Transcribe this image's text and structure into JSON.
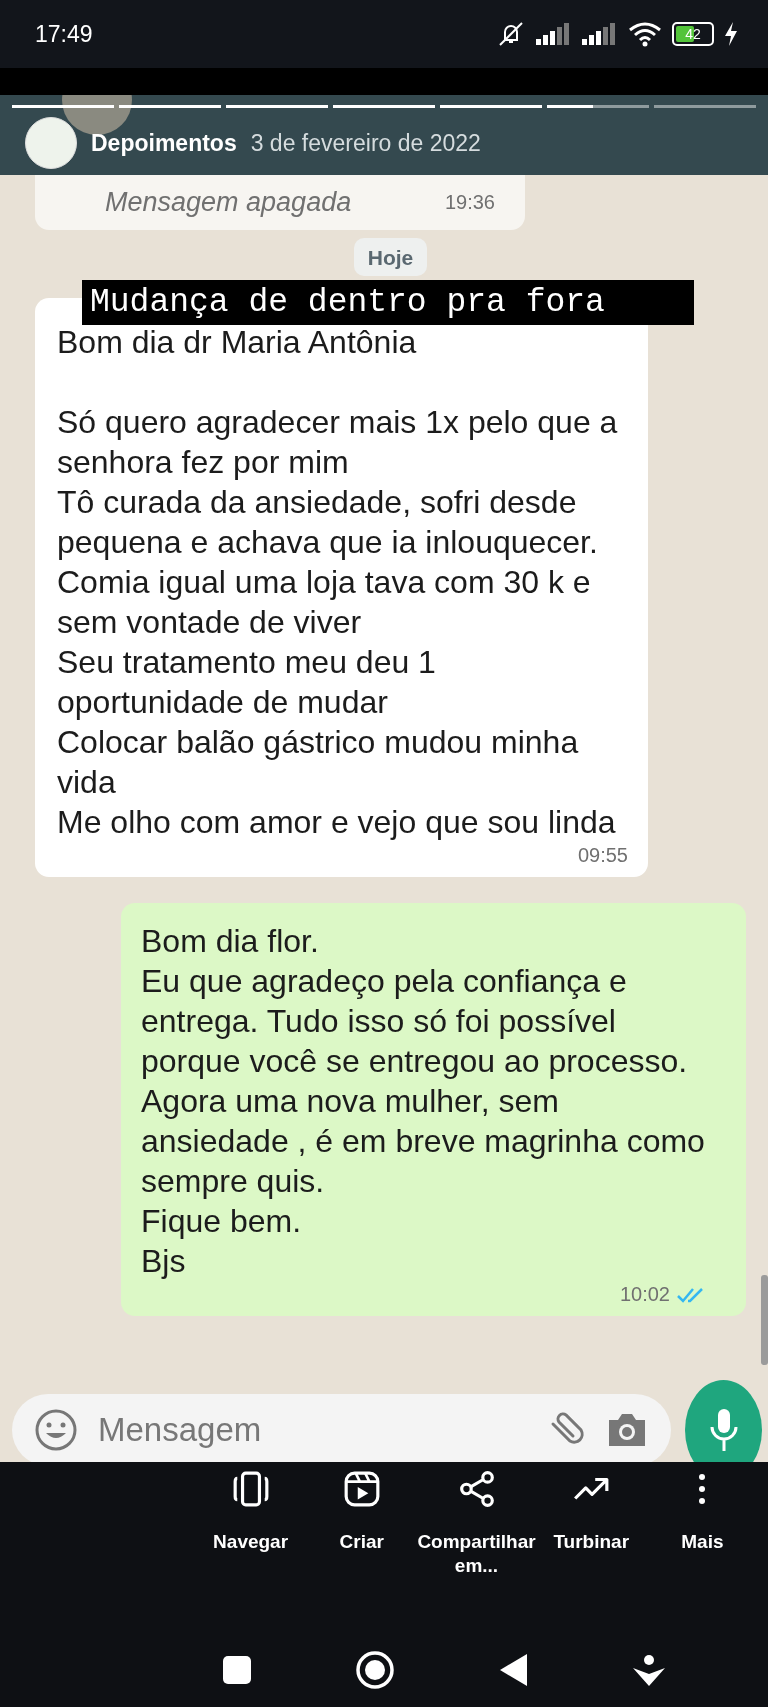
{
  "status_bar": {
    "time": "17:49",
    "battery": "42"
  },
  "story": {
    "progress": [
      {
        "level": 1
      },
      {
        "level": 1
      },
      {
        "level": 1
      },
      {
        "level": 1
      },
      {
        "level": 1
      },
      {
        "level": 0.45
      }
    ],
    "account": "Depoimentos",
    "date": "3 de fevereiro de 2022",
    "caption": "Mudança de dentro pra fora"
  },
  "chat": {
    "messages": [
      {
        "kind": "deleted",
        "text": "Mensagem apagada",
        "time": "19:36"
      },
      {
        "kind": "date",
        "text": "Hoje"
      },
      {
        "kind": "incoming",
        "text": "Bom dia dr Maria Antônia\n\nSó quero agradecer mais 1x pelo que a senhora fez por mim\nTô curada da ansiedade, sofri desde pequena e achava que ia inlouquecer.\nComia igual uma loja tava com 30 k e sem vontade de viver\nSeu tratamento meu deu 1 oportunidade de mudar\nColocar balão gástrico mudou minha vida\nMe olho com amor e vejo que sou linda",
        "time": "09:55"
      },
      {
        "kind": "outgoing",
        "text": "Bom dia flor.\nEu que agradeço pela confiança e entrega. Tudo isso só foi possível porque você se entregou ao processo.\nAgora uma nova mulher, sem ansiedade , é em breve magrinha como sempre quis.\nFique bem.\nBjs",
        "time": "10:02",
        "read": true
      }
    ],
    "input": {
      "placeholder": "Mensagem"
    }
  },
  "actions": [
    {
      "kind": "browse",
      "label": "Navegar"
    },
    {
      "kind": "create",
      "label": "Criar"
    },
    {
      "kind": "share",
      "label": "Compartilhar em..."
    },
    {
      "kind": "boost",
      "label": "Turbinar"
    },
    {
      "kind": "more",
      "label": "Mais"
    }
  ]
}
